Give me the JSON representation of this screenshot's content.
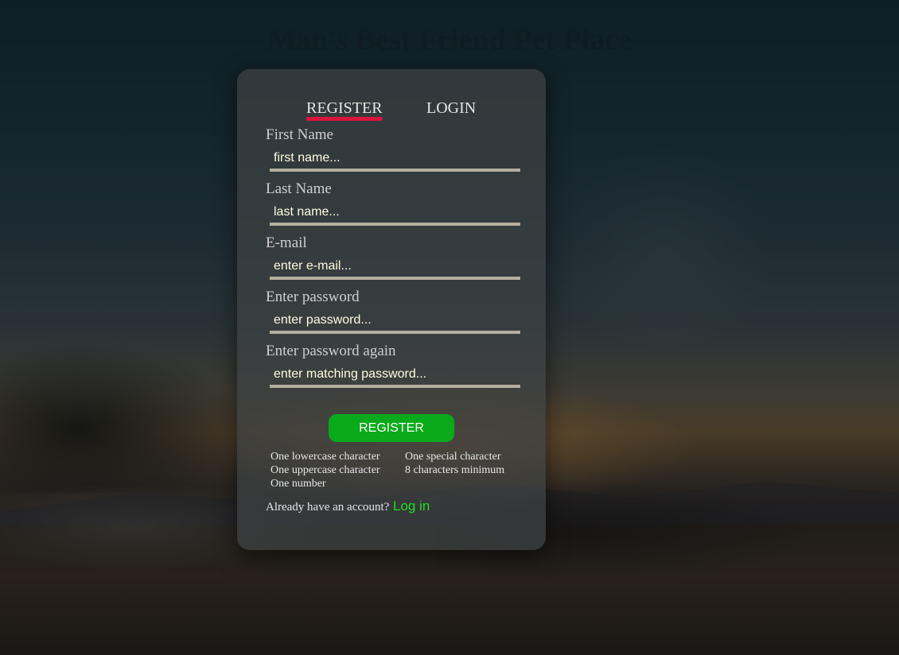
{
  "site": {
    "title": "Man's Best Friend Pet Place"
  },
  "tabs": {
    "register": "REGISTER",
    "login": "LOGIN",
    "active": "register"
  },
  "form": {
    "first_name": {
      "label": "First Name",
      "placeholder": "first name..."
    },
    "last_name": {
      "label": "Last Name",
      "placeholder": "last name..."
    },
    "email": {
      "label": "E-mail",
      "placeholder": "enter e-mail..."
    },
    "password": {
      "label": "Enter password",
      "placeholder": "enter password..."
    },
    "password_confirm": {
      "label": "Enter password again",
      "placeholder": "enter matching password..."
    },
    "submit_label": "REGISTER"
  },
  "requirements": {
    "lowercase": "One lowercase character",
    "uppercase": "One uppercase character",
    "number": "One number",
    "special": "One special character",
    "min_length": "8 characters minimum"
  },
  "footer": {
    "prompt": "Already have an account?",
    "link_label": "Log in"
  },
  "colors": {
    "tab_underline": "#dc143c",
    "register_button": "#0aab1a",
    "login_link": "#1ee01e",
    "input_underline": "#b4ae9e"
  }
}
